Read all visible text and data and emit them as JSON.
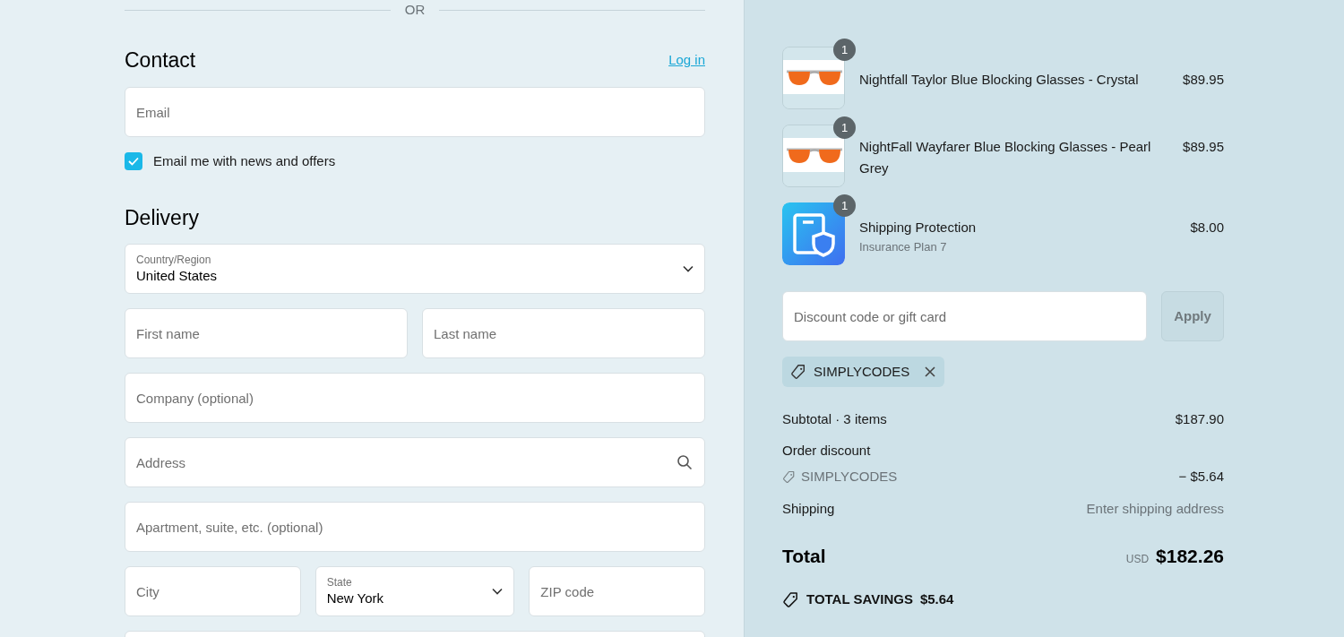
{
  "divider_label": "OR",
  "contact": {
    "heading": "Contact",
    "login_link": "Log in",
    "email": {
      "placeholder": "Email"
    },
    "newsletter": {
      "label": "Email me with news and offers",
      "checked": true
    }
  },
  "delivery": {
    "heading": "Delivery",
    "rows": [
      [
        {
          "kind": "select",
          "label": "Country/Region",
          "value": "United States"
        }
      ],
      [
        {
          "kind": "text",
          "placeholder": "First name"
        },
        {
          "kind": "text",
          "placeholder": "Last name"
        }
      ],
      [
        {
          "kind": "text",
          "placeholder": "Company (optional)"
        }
      ],
      [
        {
          "kind": "search",
          "placeholder": "Address"
        }
      ],
      [
        {
          "kind": "text",
          "placeholder": "Apartment, suite, etc. (optional)"
        }
      ],
      [
        {
          "kind": "text",
          "placeholder": "City"
        },
        {
          "kind": "select",
          "label": "State",
          "value": "New York"
        },
        {
          "kind": "text",
          "placeholder": "ZIP code"
        }
      ],
      [
        {
          "kind": "text"
        }
      ]
    ]
  },
  "cart": {
    "items": [
      {
        "kind": "glasses",
        "quantity": "1",
        "name": "Nightfall Taylor Blue Blocking Glasses - Crystal",
        "price": "$89.95"
      },
      {
        "kind": "glasses",
        "quantity": "1",
        "name": "NightFall Wayfarer Blue Blocking Glasses - Pearl Grey",
        "price": "$89.95"
      },
      {
        "kind": "protection",
        "quantity": "1",
        "name": "Shipping Protection",
        "subtitle": "Insurance Plan 7",
        "price": "$8.00"
      }
    ],
    "discount": {
      "placeholder": "Discount code or gift card",
      "button": "Apply",
      "applied_code": "SIMPLYCODES"
    },
    "summary": {
      "subtotal_label": "Subtotal · 3 items",
      "subtotal": "$187.90",
      "discount_label": "Order discount",
      "discount_code": "SIMPLYCODES",
      "discount_amount": "− $5.64",
      "shipping_label": "Shipping",
      "shipping_value": "Enter shipping address",
      "total_label": "Total",
      "currency": "USD",
      "total": "$182.26",
      "savings_label": "TOTAL SAVINGS",
      "savings": "$5.64"
    }
  }
}
